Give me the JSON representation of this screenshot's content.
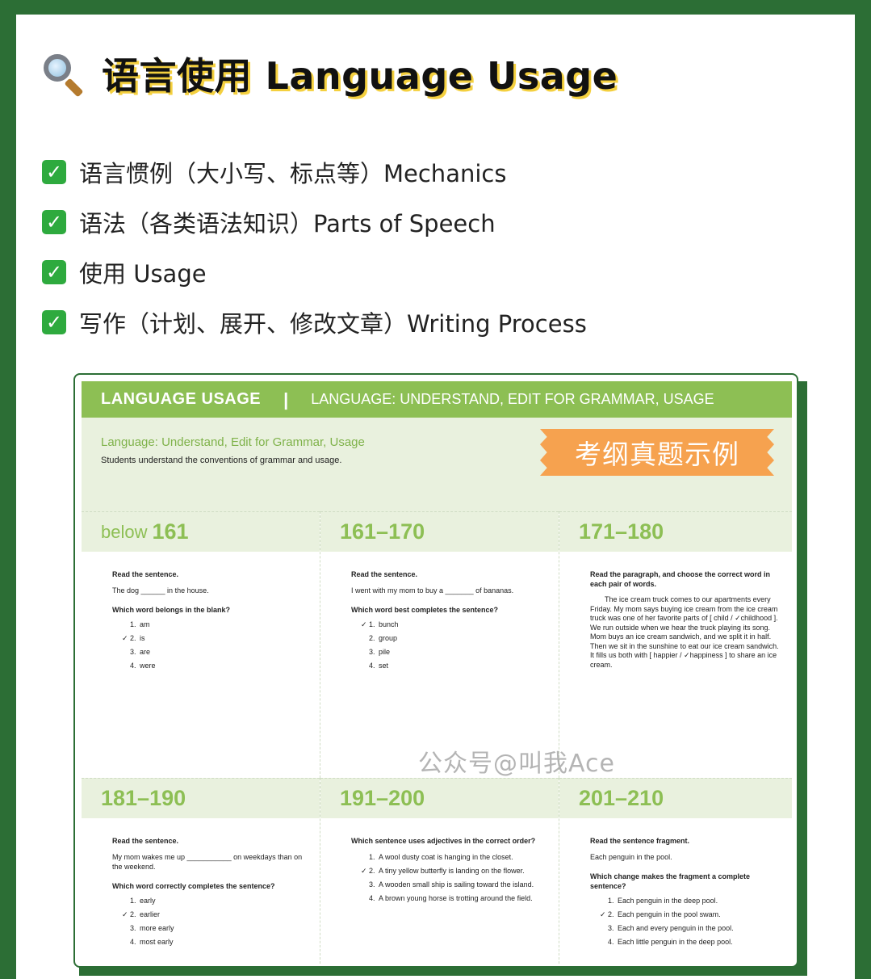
{
  "header": {
    "title": "语言使用 Language Usage",
    "icon": "search-icon"
  },
  "features": [
    "语言惯例（大小写、标点等）Mechanics",
    "语法（各类语法知识）Parts of Speech",
    "使用 Usage",
    "写作（计划、展开、修改文章）Writing Process"
  ],
  "doc": {
    "header_left": "LANGUAGE USAGE",
    "header_sep": "|",
    "header_right": "LANGUAGE: UNDERSTAND, EDIT FOR GRAMMAR, USAGE",
    "intro_title": "Language: Understand, Edit for Grammar, Usage",
    "intro_desc": "Students understand the conventions of grammar and usage.",
    "badge": "考纲真题示例",
    "cells": [
      {
        "range_prefix": "below",
        "range": "161",
        "instruction": "Read the sentence.",
        "sentence": "The dog ______ in the house.",
        "question": "Which word belongs in the blank?",
        "options": [
          {
            "num": "1.",
            "text": "am",
            "mark": ""
          },
          {
            "num": "2.",
            "text": "is",
            "mark": "✓"
          },
          {
            "num": "3.",
            "text": "are",
            "mark": ""
          },
          {
            "num": "4.",
            "text": "were",
            "mark": ""
          }
        ]
      },
      {
        "range_prefix": "",
        "range": "161–170",
        "instruction": "Read the sentence.",
        "sentence": "I went with my mom to buy a _______ of bananas.",
        "question": "Which word best completes the sentence?",
        "options": [
          {
            "num": "1.",
            "text": "bunch",
            "mark": "✓"
          },
          {
            "num": "2.",
            "text": "group",
            "mark": ""
          },
          {
            "num": "3.",
            "text": "pile",
            "mark": ""
          },
          {
            "num": "4.",
            "text": "set",
            "mark": ""
          }
        ]
      },
      {
        "range_prefix": "",
        "range": "171–180",
        "instruction": "Read the paragraph, and choose the correct word in each pair of words.",
        "paragraph": "The ice cream truck comes to our apartments every Friday. My mom says buying ice cream from the ice cream truck was one of her favorite parts of [ child / ✓childhood ]. We run outside when we hear the truck playing its song. Mom buys an ice cream sandwich, and we split it in half. Then we sit in the sunshine to eat our ice cream sandwich. It fills us both with [ happier / ✓happiness ] to share an ice cream."
      },
      {
        "range_prefix": "",
        "range": "181–190",
        "instruction": "Read the sentence.",
        "sentence": "My mom wakes me up ___________ on weekdays than on the weekend.",
        "question": "Which word correctly completes the sentence?",
        "options": [
          {
            "num": "1.",
            "text": "early",
            "mark": ""
          },
          {
            "num": "2.",
            "text": "earlier",
            "mark": "✓"
          },
          {
            "num": "3.",
            "text": "more early",
            "mark": ""
          },
          {
            "num": "4.",
            "text": "most early",
            "mark": ""
          }
        ]
      },
      {
        "range_prefix": "",
        "range": "191–200",
        "instruction": "Which sentence uses adjectives in the correct order?",
        "sentence": "",
        "question": "",
        "options": [
          {
            "num": "1.",
            "text": "A wool dusty coat is hanging in the closet.",
            "mark": ""
          },
          {
            "num": "2.",
            "text": "A tiny yellow butterfly is landing on the flower.",
            "mark": "✓"
          },
          {
            "num": "3.",
            "text": "A wooden small ship is sailing toward the island.",
            "mark": ""
          },
          {
            "num": "4.",
            "text": "A brown young horse is trotting around the field.",
            "mark": ""
          }
        ]
      },
      {
        "range_prefix": "",
        "range": "201–210",
        "instruction": "Read the sentence fragment.",
        "sentence": "Each penguin in the pool.",
        "question": "Which change makes the fragment a complete sentence?",
        "options": [
          {
            "num": "1.",
            "text": "Each penguin in the deep pool.",
            "mark": ""
          },
          {
            "num": "2.",
            "text": "Each penguin in the pool swam.",
            "mark": "✓"
          },
          {
            "num": "3.",
            "text": "Each and every penguin in the pool.",
            "mark": ""
          },
          {
            "num": "4.",
            "text": "Each little penguin in the deep pool.",
            "mark": ""
          }
        ]
      }
    ]
  },
  "watermark": "公众号@叫我Ace",
  "colors": {
    "background": "#2c6e35",
    "accent_green": "#8dbf54",
    "badge_orange": "#f6a24f",
    "check_green": "#2eaa3e",
    "title_shadow": "#f4d03f"
  }
}
